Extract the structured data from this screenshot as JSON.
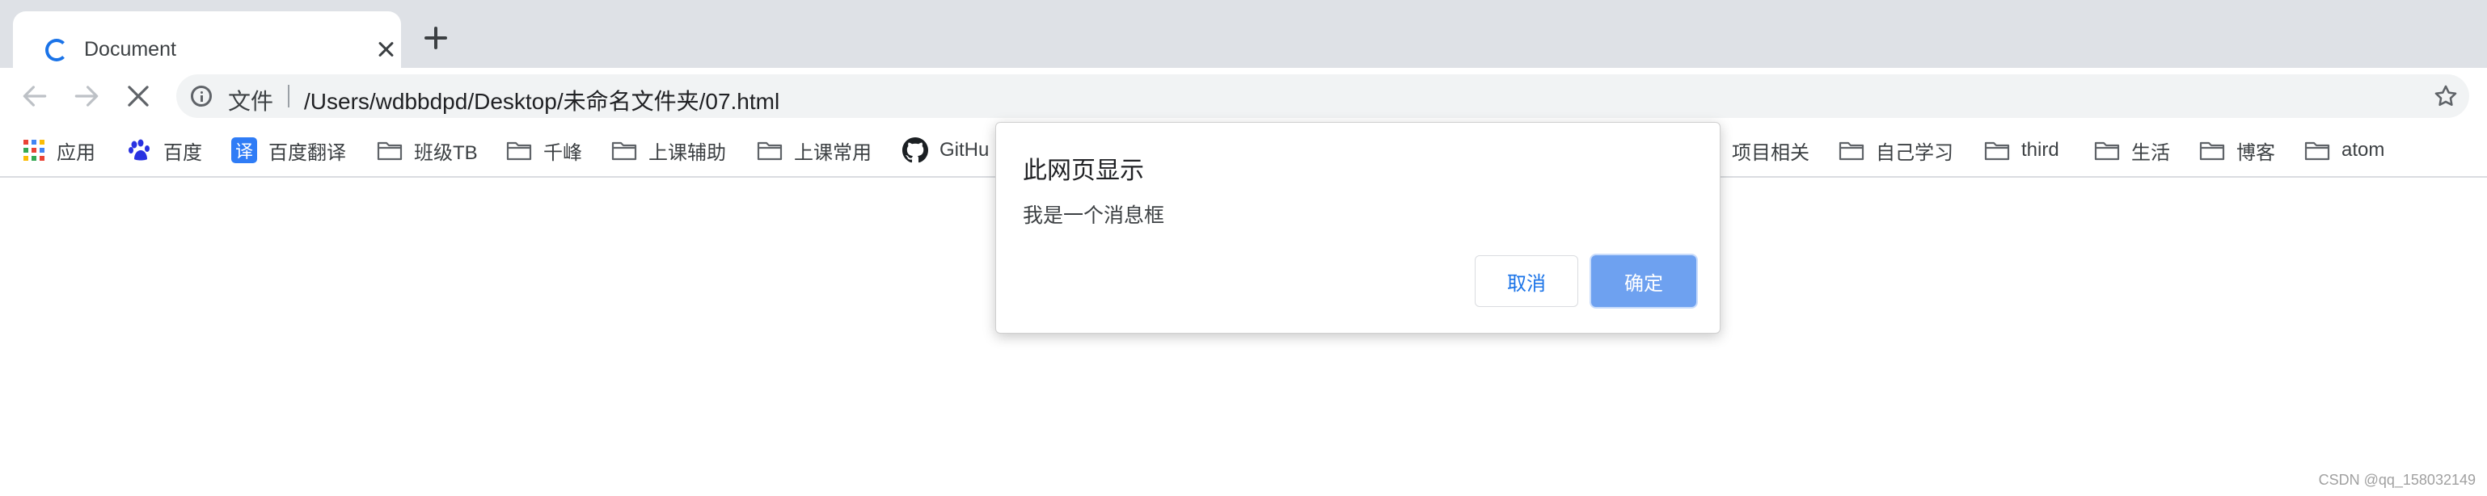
{
  "tab": {
    "title": "Document"
  },
  "omnibox": {
    "scheme_label": "文件",
    "url": "/Users/wdbbdpd/Desktop/未命名文件夹/07.html"
  },
  "bookmarks": [
    {
      "label": "应用",
      "icon": "apps-grid-icon"
    },
    {
      "label": "百度",
      "icon": "baidu-paw-icon"
    },
    {
      "label": "百度翻译",
      "icon": "translate-icon"
    },
    {
      "label": "班级TB",
      "icon": "folder-icon"
    },
    {
      "label": "千峰",
      "icon": "folder-icon"
    },
    {
      "label": "上课辅助",
      "icon": "folder-icon"
    },
    {
      "label": "上课常用",
      "icon": "folder-icon"
    },
    {
      "label": "GitHu",
      "icon": "github-icon"
    },
    {
      "label": "项目相关",
      "icon": "folder-icon"
    },
    {
      "label": "自己学习",
      "icon": "folder-icon"
    },
    {
      "label": "third",
      "icon": "folder-icon"
    },
    {
      "label": "生活",
      "icon": "folder-icon"
    },
    {
      "label": "博客",
      "icon": "folder-icon"
    },
    {
      "label": "atom",
      "icon": "folder-icon"
    }
  ],
  "dialog": {
    "title": "此网页显示",
    "message": "我是一个消息框",
    "cancel_label": "取消",
    "ok_label": "确定"
  },
  "watermark": "CSDN @qq_158032149",
  "colors": {
    "accent": "#1a73e8",
    "ok_button": "#6ea1f0",
    "tabstrip": "#dee1e6"
  }
}
